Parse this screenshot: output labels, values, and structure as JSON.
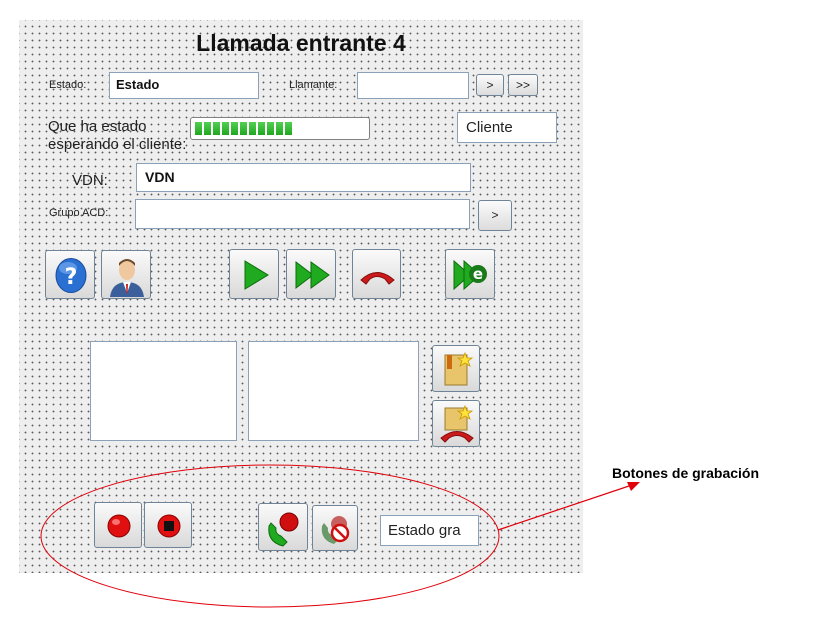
{
  "window": {
    "title": "Llamada entrante 4"
  },
  "estado": {
    "label": "Estado:",
    "value": "Estado"
  },
  "llamante": {
    "label": "Llamante:",
    "value": "",
    "next_label": ">",
    "more_label": ">>"
  },
  "wait": {
    "label_line1": "Que ha estado",
    "label_line2": "esperando el cliente:",
    "progress": 0.6
  },
  "cliente": {
    "label": "Cliente"
  },
  "vdn": {
    "label": "VDN:",
    "value": "VDN"
  },
  "grupo_acd": {
    "label": "Grupo ACD:",
    "value": "",
    "button_label": ">"
  },
  "recording": {
    "status_text": "Estado gra"
  },
  "annotation": {
    "text": "Botones de grabación",
    "color": "#e0000a"
  },
  "colors": {
    "accent_green": "#1faa1f",
    "phone_red": "#cc1a1a",
    "help_blue": "#2a6fd2"
  }
}
